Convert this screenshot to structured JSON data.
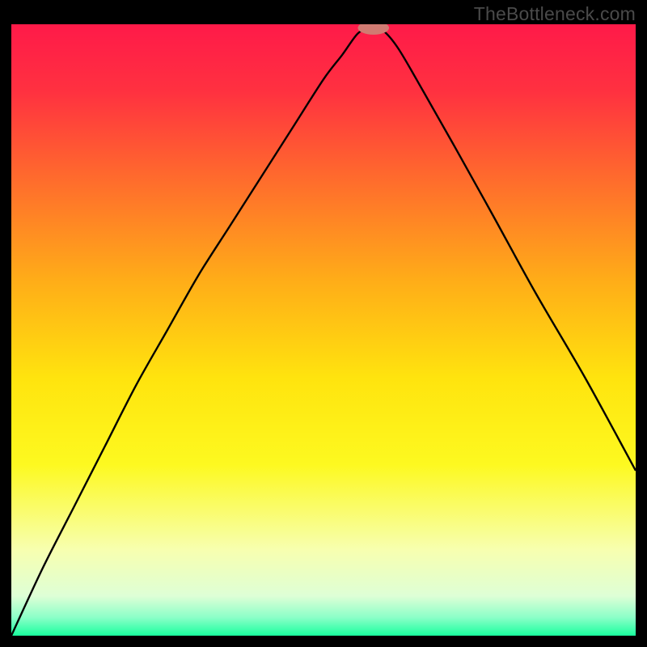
{
  "watermark": "TheBottleneck.com",
  "chart_data": {
    "type": "line",
    "title": "",
    "xlabel": "",
    "ylabel": "",
    "xlim": [
      0,
      100
    ],
    "ylim": [
      0,
      100
    ],
    "background_gradient": {
      "stops": [
        {
          "pct": 0,
          "color": "#ff1a49"
        },
        {
          "pct": 11,
          "color": "#ff3140"
        },
        {
          "pct": 25,
          "color": "#ff6a2d"
        },
        {
          "pct": 42,
          "color": "#ffad18"
        },
        {
          "pct": 58,
          "color": "#ffe40e"
        },
        {
          "pct": 72,
          "color": "#fdf920"
        },
        {
          "pct": 86,
          "color": "#f7ffb0"
        },
        {
          "pct": 93.5,
          "color": "#deffd6"
        },
        {
          "pct": 97,
          "color": "#8cffc8"
        },
        {
          "pct": 100,
          "color": "#19ff9e"
        }
      ]
    },
    "marker": {
      "x": 58.0,
      "y": 99.4,
      "rx": 2.5,
      "ry": 1.1,
      "color": "#d07b72"
    },
    "series": [
      {
        "name": "bottleneck-curve",
        "stroke": "#000000",
        "x": [
          0,
          5,
          10,
          15,
          20,
          25,
          30,
          35,
          40,
          45,
          50,
          53,
          55.5,
          57.5,
          59.5,
          62,
          66,
          71,
          77,
          84,
          92,
          100
        ],
        "y": [
          0,
          11,
          21,
          31,
          41,
          50,
          59,
          67,
          75,
          83,
          91,
          95,
          98.5,
          99.5,
          99.0,
          96,
          89,
          80,
          69,
          56,
          42,
          27
        ]
      }
    ]
  }
}
